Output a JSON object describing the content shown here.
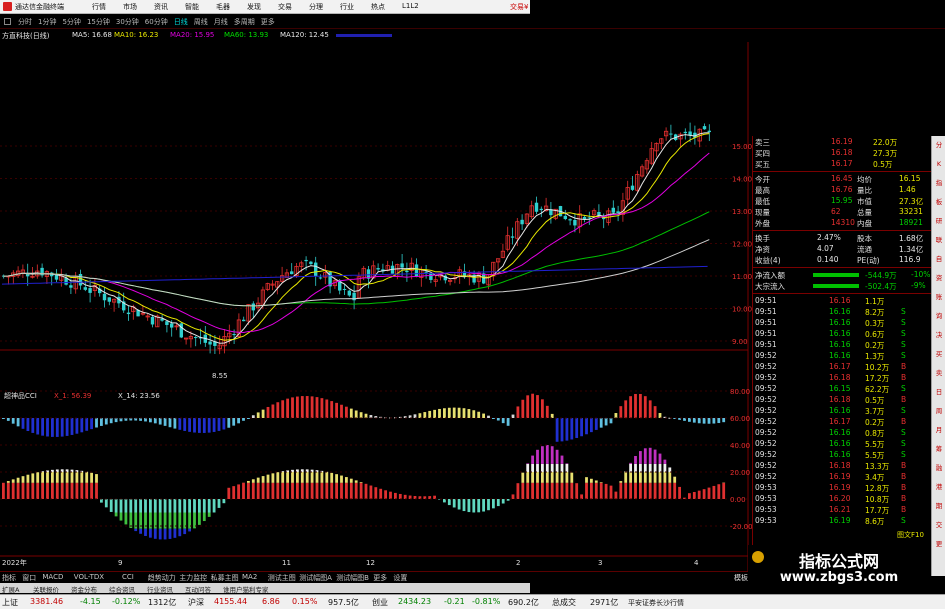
{
  "titlebar": {
    "app_title": "通达信金融终端",
    "menu": [
      "行情",
      "市场",
      "资讯",
      "智能",
      "毛器",
      "发现",
      "交易",
      "分理",
      "行业",
      "热点",
      "L1L2"
    ],
    "right_label": "交易¥"
  },
  "periods": {
    "items": [
      "分时",
      "1分钟",
      "5分钟",
      "15分钟",
      "30分钟",
      "60分钟",
      "日线",
      "周线",
      "月线",
      "多周期",
      "更多"
    ],
    "active_index": 6
  },
  "ma_bar": {
    "stock": "方直科技(日线)",
    "ma5": "MA5: 16.68",
    "ma10": "MA10: 16.23",
    "ma20": "MA20: 15.95",
    "ma60": "MA60: 13.93",
    "ma120": "MA120: 12.45",
    "colors": {
      "ma5": "#e8e8e8",
      "ma10": "#e8e800",
      "ma20": "#e000e0",
      "ma60": "#00e000",
      "ma120": "#e8e8e8"
    }
  },
  "main_chart": {
    "price_axis": [
      "15.00",
      "14.00",
      "13.00",
      "12.00",
      "11.00",
      "10.00",
      "9.00"
    ],
    "low_marker": "8.55",
    "colors": {
      "up": "#e83030",
      "down": "#30d0d0",
      "ma5": "#e8e8e8",
      "ma10": "#e8e800",
      "ma20": "#e000e0",
      "ma60": "#00c000",
      "long": "#d0d0d0",
      "ma250": "#2020d0"
    }
  },
  "indicator": {
    "name": "超神品CCI",
    "value_a": "X_1: 56.39",
    "value_b": "X_14: 23.56",
    "axis": [
      "80.00",
      "60.00",
      "40.00",
      "20.00",
      "0.00",
      "-20.00"
    ]
  },
  "date_axis": {
    "labels": [
      "2022年",
      "9",
      "11",
      "12",
      "2",
      "3",
      "4"
    ]
  },
  "quote": {
    "top_rows": [
      {
        "label": "卖三",
        "price": "16.19",
        "vol": "22.0万"
      },
      {
        "label": "买四",
        "price": "16.18",
        "vol": "27.3万"
      },
      {
        "label": "买五",
        "price": "16.17",
        "vol": "0.5万"
      }
    ],
    "stats": [
      {
        "l1": "今开",
        "v1": "16.45",
        "l2": "均价",
        "v2": "16.15"
      },
      {
        "l1": "最高",
        "v1": "16.76",
        "l2": "量比",
        "v2": "1.46"
      },
      {
        "l1": "最低",
        "v1": "15.95",
        "l2": "市值",
        "v2": "27.3亿"
      },
      {
        "l1": "现量",
        "v1": "62",
        "l2": "总量",
        "v2": "33231"
      },
      {
        "l1": "外盘",
        "v1": "14310",
        "l2": "内盘",
        "v2": "18921"
      }
    ],
    "stats2": [
      {
        "l1": "换手",
        "v1": "2.47%",
        "l2": "股本",
        "v2": "1.68亿"
      },
      {
        "l1": "净资",
        "v1": "4.07",
        "l2": "流通",
        "v2": "1.34亿"
      },
      {
        "l1": "收益(4)",
        "v1": "0.140",
        "l2": "PE(动)",
        "v2": "116.9"
      }
    ],
    "flows": [
      {
        "label": "净流入额",
        "value": "-544.9万",
        "pct": "-10%"
      },
      {
        "label": "大宗流入",
        "value": "-502.4万",
        "pct": "-9%"
      }
    ],
    "ticks": [
      {
        "t": "09:51",
        "p": "16.16",
        "v": "1.1万",
        "s": ""
      },
      {
        "t": "09:51",
        "p": "16.16",
        "v": "8.2万",
        "s": "S"
      },
      {
        "t": "09:51",
        "p": "16.16",
        "v": "0.3万",
        "s": "S"
      },
      {
        "t": "09:51",
        "p": "16.16",
        "v": "0.6万",
        "s": "S"
      },
      {
        "t": "09:51",
        "p": "16.16",
        "v": "0.2万",
        "s": "S"
      },
      {
        "t": "09:52",
        "p": "16.16",
        "v": "1.3万",
        "s": "S"
      },
      {
        "t": "09:52",
        "p": "16.17",
        "v": "10.2万",
        "s": "B"
      },
      {
        "t": "09:52",
        "p": "16.18",
        "v": "17.2万",
        "s": "B"
      },
      {
        "t": "09:52",
        "p": "16.15",
        "v": "62.2万",
        "s": "S"
      },
      {
        "t": "09:52",
        "p": "16.18",
        "v": "0.5万",
        "s": "B"
      },
      {
        "t": "09:52",
        "p": "16.16",
        "v": "3.7万",
        "s": "S"
      },
      {
        "t": "09:52",
        "p": "16.17",
        "v": "0.2万",
        "s": "B"
      },
      {
        "t": "09:52",
        "p": "16.16",
        "v": "0.8万",
        "s": "S"
      },
      {
        "t": "09:52",
        "p": "16.16",
        "v": "5.5万",
        "s": "S"
      },
      {
        "t": "09:52",
        "p": "16.16",
        "v": "5.5万",
        "s": "S"
      },
      {
        "t": "09:52",
        "p": "16.18",
        "v": "13.3万",
        "s": "B"
      },
      {
        "t": "09:52",
        "p": "16.19",
        "v": "3.4万",
        "s": "B"
      },
      {
        "t": "09:53",
        "p": "16.19",
        "v": "12.8万",
        "s": "B"
      },
      {
        "t": "09:53",
        "p": "16.20",
        "v": "10.8万",
        "s": "B"
      },
      {
        "t": "09:53",
        "p": "16.21",
        "v": "17.7万",
        "s": "B"
      },
      {
        "t": "09:53",
        "p": "16.19",
        "v": "8.6万",
        "s": "S"
      }
    ],
    "bottom_label": "图文F10"
  },
  "sidebar": [
    "分",
    "K",
    "指",
    "板",
    "研",
    "联",
    "自",
    "资",
    "账",
    "询",
    "决",
    "买",
    "卖",
    "日",
    "周",
    "月",
    "筹",
    "融",
    "港",
    "期",
    "交",
    "更"
  ],
  "tabs": {
    "items": [
      "指标",
      "窗口",
      "MACD",
      "VOL-TDX",
      "CCI",
      "趋势动力",
      "主力监控",
      "私募主图",
      "MA2",
      "测试主图",
      "测试幅图A",
      "测试幅图B",
      "更多",
      "设置"
    ],
    "right_label": "模板"
  },
  "subtabs": {
    "items": [
      "扩展A",
      "关联报价",
      "资金分布",
      "综合资讯",
      "行业资讯",
      "互动问答",
      "谁用户猫利专家"
    ]
  },
  "status": {
    "sh_label": "上证",
    "sh_val": "3381.46",
    "sh_chg": "-4.15",
    "sh_pct": "-0.12%",
    "sh_amt": "1312亿",
    "hs_label": "沪深",
    "hs_val": "4155.44",
    "hs_chg": "6.86",
    "hs_pct": "0.15%",
    "hs_amt": "957.5亿",
    "cy_label": "创业",
    "cy_val": "2434.23",
    "cy_chg": "-0.21",
    "cy_pct": "-0.81%",
    "cy_amt": "690.2亿",
    "total_label": "总成交",
    "total_val": "2971亿",
    "broker": "平安证券长沙行情"
  },
  "watermark": {
    "title": "指标公式网",
    "url": "www.zbgs3.com"
  }
}
